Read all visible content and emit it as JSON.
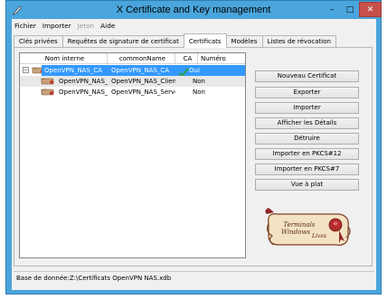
{
  "window": {
    "title": "X Certificate and Key management",
    "controls": {
      "minimize": "–",
      "maximize": "□",
      "close": "✕"
    }
  },
  "menu": [
    {
      "label": "Fichier",
      "enabled": true
    },
    {
      "label": "Importer",
      "enabled": true
    },
    {
      "label": "Jeton",
      "enabled": false
    },
    {
      "label": "Aide",
      "enabled": true
    }
  ],
  "tabs": [
    {
      "label": "Clés privées",
      "active": false
    },
    {
      "label": "Requêtes de signature de certificat",
      "active": false
    },
    {
      "label": "Certificats",
      "active": true
    },
    {
      "label": "Modèles",
      "active": false
    },
    {
      "label": "Listes de révocation",
      "active": false
    }
  ],
  "tree": {
    "columns": [
      "Nom interne",
      "commonName",
      "CA",
      "Numéro"
    ],
    "rows": [
      {
        "name": "OpenVPN_NAS_CA",
        "cn": "OpenVPN_NAS_CA",
        "ca": "Oui",
        "expander": "−",
        "selected": true
      },
      {
        "name": "OpenVPN_NAS_Client",
        "cn": "OpenVPN_NAS_Client",
        "ca": "Non",
        "selected": false
      },
      {
        "name": "OpenVPN_NAS_Server",
        "cn": "OpenVPN_NAS_Server",
        "ca": "Non",
        "selected": false
      }
    ]
  },
  "actions": [
    "Nouveau Certificat",
    "Exporter",
    "Importer",
    "Afficher les Détails",
    "Détruire",
    "Importer en PKCS#12",
    "Importer en PKCS#7",
    "Vue à plat"
  ],
  "logo": {
    "line1": "Terminals",
    "line2": "Windows",
    "line3": "Lives"
  },
  "status": {
    "text": "Base de donnée:Z:\\Certificats OpenVPN NAS.xdb"
  },
  "colors": {
    "titlebar": "#4aa5dc",
    "selection": "#3399ff",
    "close": "#c7504a"
  }
}
